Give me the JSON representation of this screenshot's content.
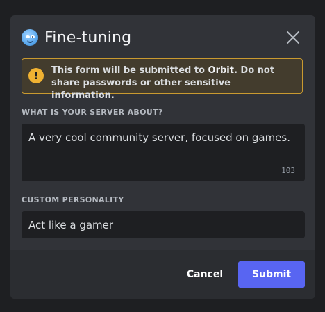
{
  "modal": {
    "title": "Fine-tuning",
    "avatar_icon": "winking-bot-face-icon",
    "close_icon": "close-icon"
  },
  "warning": {
    "icon": "exclamation-icon",
    "text_before": "This form will be submitted to ",
    "app_name": "Orbit",
    "text_after": ". Do not share passwords or other sensitive information."
  },
  "fields": {
    "server_about": {
      "label": "WHAT IS YOUR SERVER ABOUT?",
      "value": "A very cool community server, focused on games.",
      "char_count": "103"
    },
    "custom_personality": {
      "label": "CUSTOM PERSONALITY",
      "value": "Act like a gamer"
    }
  },
  "footer": {
    "cancel_label": "Cancel",
    "submit_label": "Submit"
  },
  "colors": {
    "accent": "#5865f2",
    "warning": "#f0b232",
    "modal_bg": "#313338",
    "footer_bg": "#2b2d31"
  }
}
